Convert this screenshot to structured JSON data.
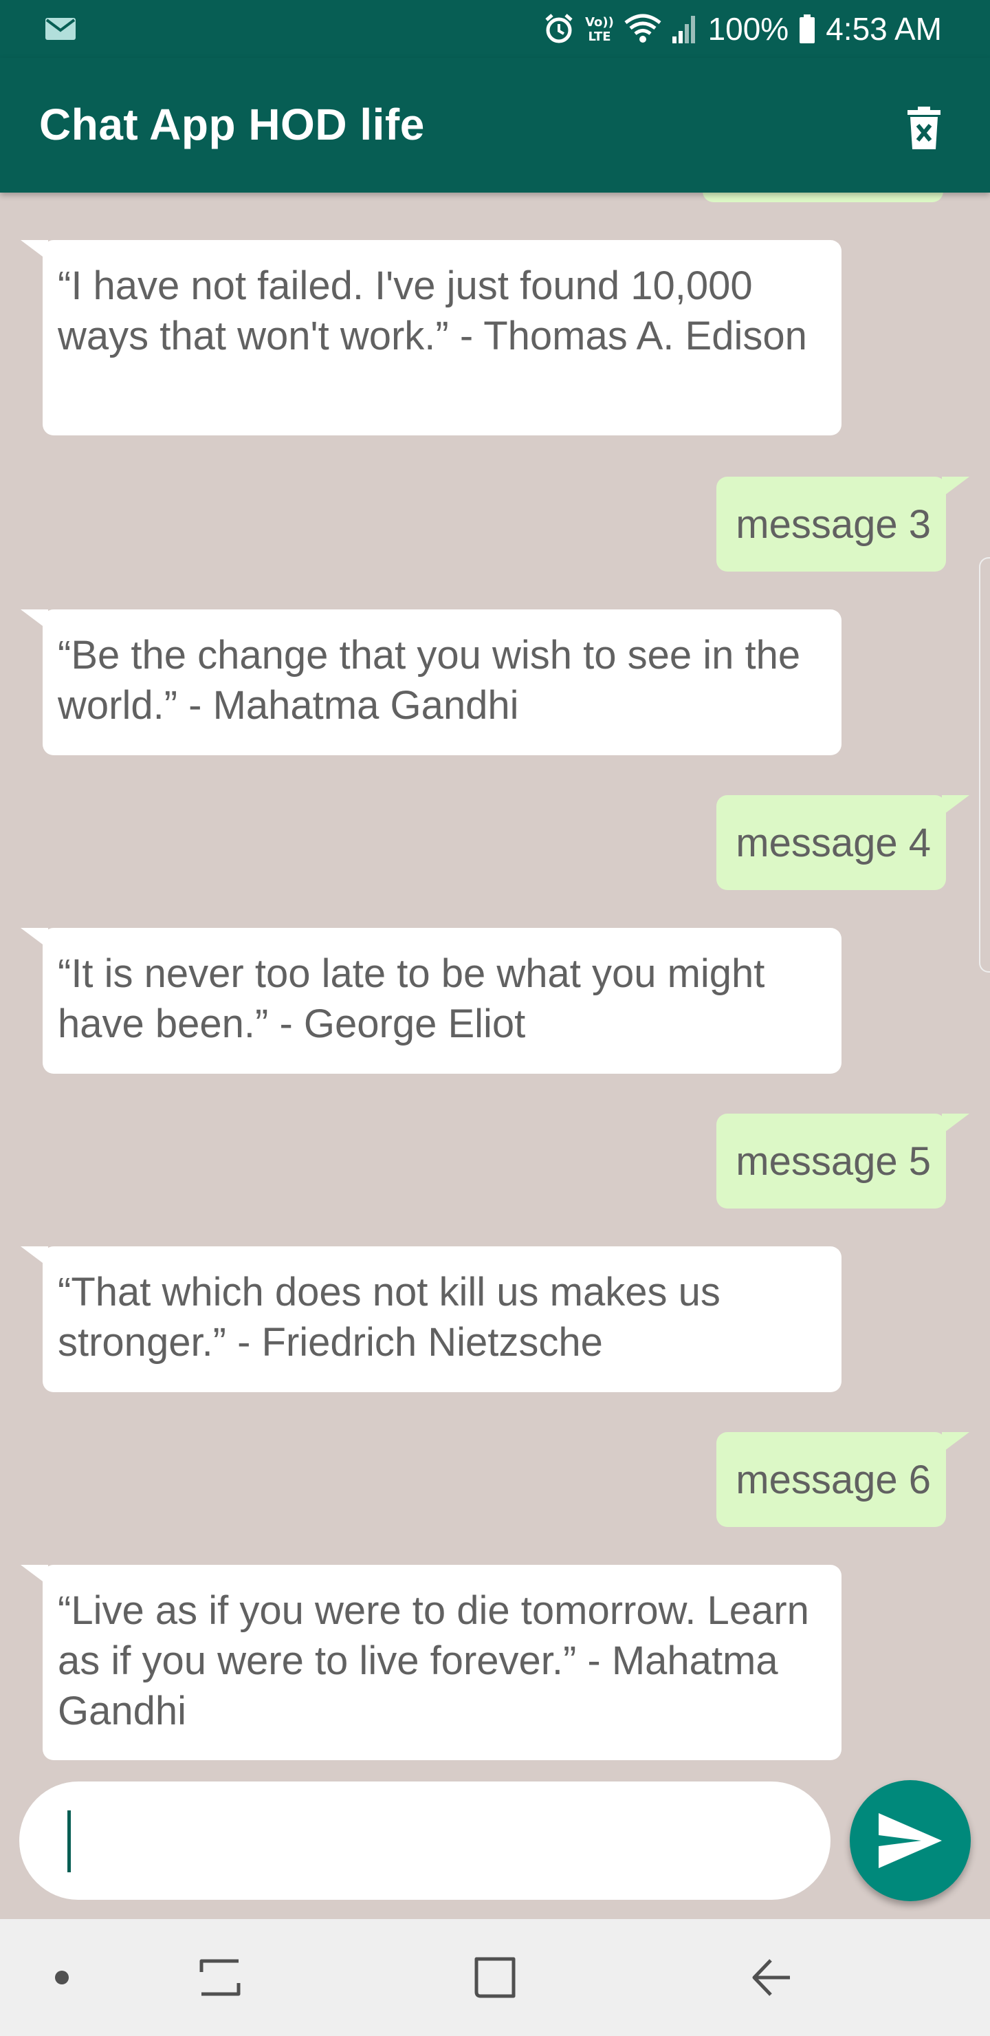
{
  "status_bar": {
    "battery": "100%",
    "time": "4:53 AM",
    "icons": [
      "mail-icon",
      "alarm-icon",
      "volte-icon",
      "wifi-icon",
      "signal-icon",
      "battery-icon"
    ],
    "volte_label": "Vo)) LTE"
  },
  "app_bar": {
    "title": "Chat App HOD life",
    "action_icon": "delete-sweep-icon"
  },
  "messages": [
    {
      "type": "in",
      "text": "“I have not failed. I've just found 10,000 ways that won't work.” - Thomas A. Edison"
    },
    {
      "type": "out",
      "text": "message 3"
    },
    {
      "type": "in",
      "text": "“Be the change that you wish to see in the world.” - Mahatma Gandhi"
    },
    {
      "type": "out",
      "text": "message 4"
    },
    {
      "type": "in",
      "text": "“It is never too late to be what you might have been.” - George Eliot"
    },
    {
      "type": "out",
      "text": "message 5"
    },
    {
      "type": "in",
      "text": "“That which does not kill us makes us stronger.” - Friedrich Nietzsche"
    },
    {
      "type": "out",
      "text": "message 6"
    },
    {
      "type": "in",
      "text": "“Live as if you were to die tomorrow. Learn as if you were to live forever.” - Mahatma Gandhi"
    }
  ],
  "composer": {
    "value": "",
    "placeholder": "",
    "send_icon": "send-icon"
  },
  "nav_bar": {
    "icons": [
      "dot-icon",
      "recents-icon",
      "home-icon",
      "back-icon"
    ]
  },
  "colors": {
    "primary": "#075e54",
    "accent": "#00897b",
    "background": "#d7ccc8",
    "incoming_bubble": "#ffffff",
    "outgoing_bubble": "#dcf8c6"
  }
}
